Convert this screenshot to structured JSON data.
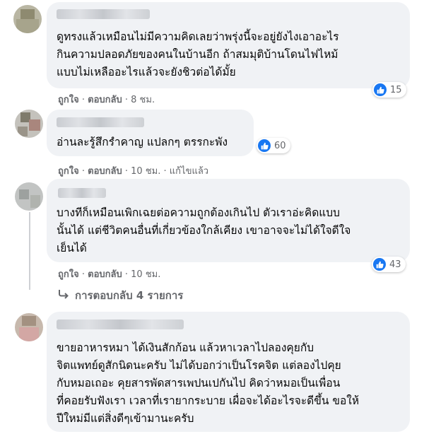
{
  "comments": [
    {
      "text": "ดูทรงแล้วเหมือนไม่มีความคิดเลยว่าพรุ่งนี้จะอยู่ยังไงเอาอะไร\nกินความปลอดภัยของคนในบ้านอีก ถ้าสมมุติบ้านโดนไฟไหม้\nแบบไม่เหลืออะไรแล้วจะยังชิวต่อได้มั้ย",
      "like_label": "ถูกใจ",
      "reply_label": "ตอบกลับ",
      "time": "8 ชม.",
      "reaction_count": "15"
    },
    {
      "text": "อ่านละรู้สึกรำคาญ แปลกๆ ตรรกะพัง",
      "like_label": "ถูกใจ",
      "reply_label": "ตอบกลับ",
      "time": "10 ชม.",
      "edited": "แก้ไขแล้ว",
      "reaction_count": "60"
    },
    {
      "text": "บางทีก็เหมือนเพิกเฉยต่อความถูกต้องเกินไป ตัวเราอ่ะคิดแบบ\nนั้นได้ แต่ชีวิตคนอื่นที่เกี่ยวข้องใกล้เคียง เขาอาจจะไม่ได้ใจดีใจ\nเย็นได้",
      "like_label": "ถูกใจ",
      "reply_label": "ตอบกลับ",
      "time": "10 ชม.",
      "reaction_count": "43",
      "replies_label": "การตอบกลับ 4 รายการ"
    },
    {
      "text": "ขายอาหารหมา ได้เงินสักก้อน แล้วหาเวลาไปลองคุยกับ\nจิตแพทย์ดูสักนิดนะครับ ไม่ได้บอกว่าเป็นโรคจิต แต่ลองไปคุย\nกับหมอเถอะ คุยสารพัดสารเพปนเปกันไป คิดว่าหมอเป็นเพื่อน\nที่คอยรับฟังเรา เวลาที่เรายากระบาย เผื่อจะได้อะไรจะดีขึ้น ขอให้\nปีใหม่มีแต่สิ่งดีๆเข้ามานะครับ"
    }
  ],
  "separator": "·",
  "colors": {
    "bubble": "#f0f2f5",
    "meta_text": "#65676b",
    "like_blue": "#1877f2"
  },
  "icons": {
    "reaction": "thumbs-up-icon",
    "replies": "reply-arrow-icon"
  }
}
